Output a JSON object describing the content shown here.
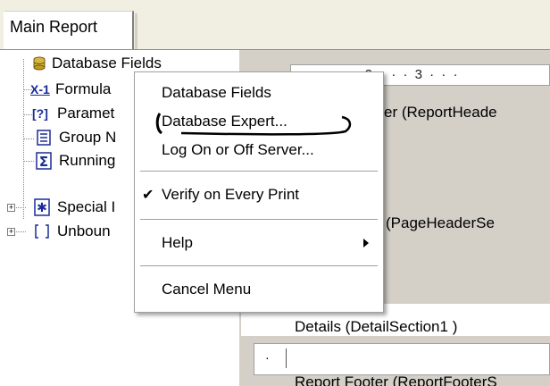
{
  "tab": {
    "label": "Main Report"
  },
  "tree": {
    "items": [
      {
        "label": "Database Fields",
        "icon": "database-icon"
      },
      {
        "label": "Formula",
        "icon": "formula-icon",
        "glyph": "X-1"
      },
      {
        "label": "Paramet",
        "icon": "parameter-icon",
        "glyph": "[?]"
      },
      {
        "label": "Group N",
        "icon": "group-icon"
      },
      {
        "label": "Running",
        "icon": "running-total-icon",
        "glyph": "Σ"
      },
      {
        "label": "Special I",
        "icon": "special-fields-icon"
      },
      {
        "label": "Unboun",
        "icon": "unbound-fields-icon"
      }
    ]
  },
  "design": {
    "ruler_text": "· · · · 2 · · · 3 · · ·",
    "report_header": "er (ReportHeade",
    "page_header": "(PageHeaderSe",
    "details": "Details  (DetailSection1 )",
    "report_footer": "Report Footer  (ReportFooterS",
    "row_marker": "·"
  },
  "context_menu": {
    "items": [
      {
        "label": "Database Fields"
      },
      {
        "label": "Database Expert..."
      },
      {
        "label": "Log On or Off Server..."
      },
      {
        "label": "Verify on Every Print",
        "checked": true
      },
      {
        "label": "Help",
        "has_submenu": true
      },
      {
        "label": "Cancel Menu"
      }
    ]
  },
  "colors": {
    "background": "#f1efe2",
    "design_surface": "#d4d0c8",
    "accent_icon": "#1a2c96"
  }
}
